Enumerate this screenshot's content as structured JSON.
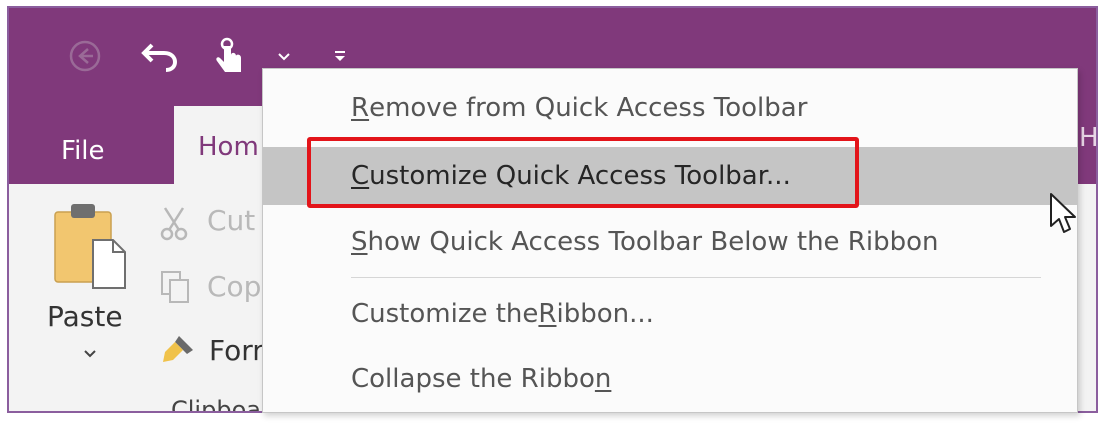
{
  "titlebar": {
    "color": "#80397b"
  },
  "qat": [
    {
      "icon": "back-arrow-icon"
    },
    {
      "icon": "undo-icon"
    },
    {
      "icon": "touch-mode-icon"
    },
    {
      "icon": "chevron-down-icon"
    },
    {
      "icon": "customize-toolbar-dropdown-icon"
    }
  ],
  "tabs": {
    "file": "File",
    "home": "Hom",
    "partial_right": "H"
  },
  "clipboard": {
    "paste": "Paste",
    "cut": "Cut",
    "copy": "Cop",
    "format_painter": "Form",
    "group_label": "Clipboa"
  },
  "context_menu": {
    "items": [
      {
        "pre": "",
        "mnemonic": "R",
        "post": "emove from Quick Access Toolbar",
        "highlighted": false
      },
      {
        "pre": "",
        "mnemonic": "C",
        "post": "ustomize Quick Access Toolbar...",
        "highlighted": true
      },
      {
        "pre": "",
        "mnemonic": "S",
        "post": "how Quick Access Toolbar Below the Ribbon",
        "highlighted": false
      },
      {
        "pre": "Customize the ",
        "mnemonic": "R",
        "post": "ibbon...",
        "highlighted": false
      },
      {
        "pre": "Collapse the Ribbo",
        "mnemonic": "n",
        "post": "",
        "highlighted": false
      }
    ]
  },
  "highlight_color": "#e3141a"
}
